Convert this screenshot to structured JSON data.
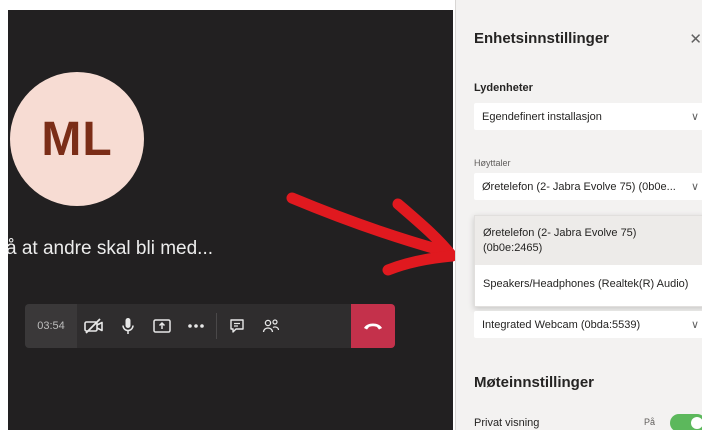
{
  "call": {
    "avatar_initials": "ML",
    "waiting_text": "å at andre skal bli med...",
    "timer": "03:54",
    "controls": {
      "camera_icon": "camera-off-icon",
      "mic_icon": "microphone-icon",
      "share_icon": "share-screen-icon",
      "more_icon": "more-icon",
      "chat_icon": "chat-icon",
      "participants_icon": "participants-icon",
      "hangup_icon": "hang-up-icon"
    },
    "hangup_color": "#c4314b"
  },
  "settings": {
    "title": "Enhetsinnstillinger",
    "audio_devices_label": "Lydenheter",
    "audio_devices_value": "Egendefinert installasjon",
    "speaker_label": "Høyttaler",
    "speaker_value": "Øretelefon (2- Jabra Evolve 75) (0b0e...",
    "speaker_options": [
      "Øretelefon (2- Jabra Evolve 75) (0b0e:2465)",
      "Speakers/Headphones (Realtek(R) Audio)"
    ],
    "camera_value": "Integrated Webcam (0bda:5539)",
    "meeting_settings_title": "Møteinnstillinger",
    "private_view_label": "Privat visning",
    "private_view_state": "På",
    "toggle_color": "#5cb85c"
  },
  "annotation": {
    "arrow_color": "#e0191f"
  }
}
